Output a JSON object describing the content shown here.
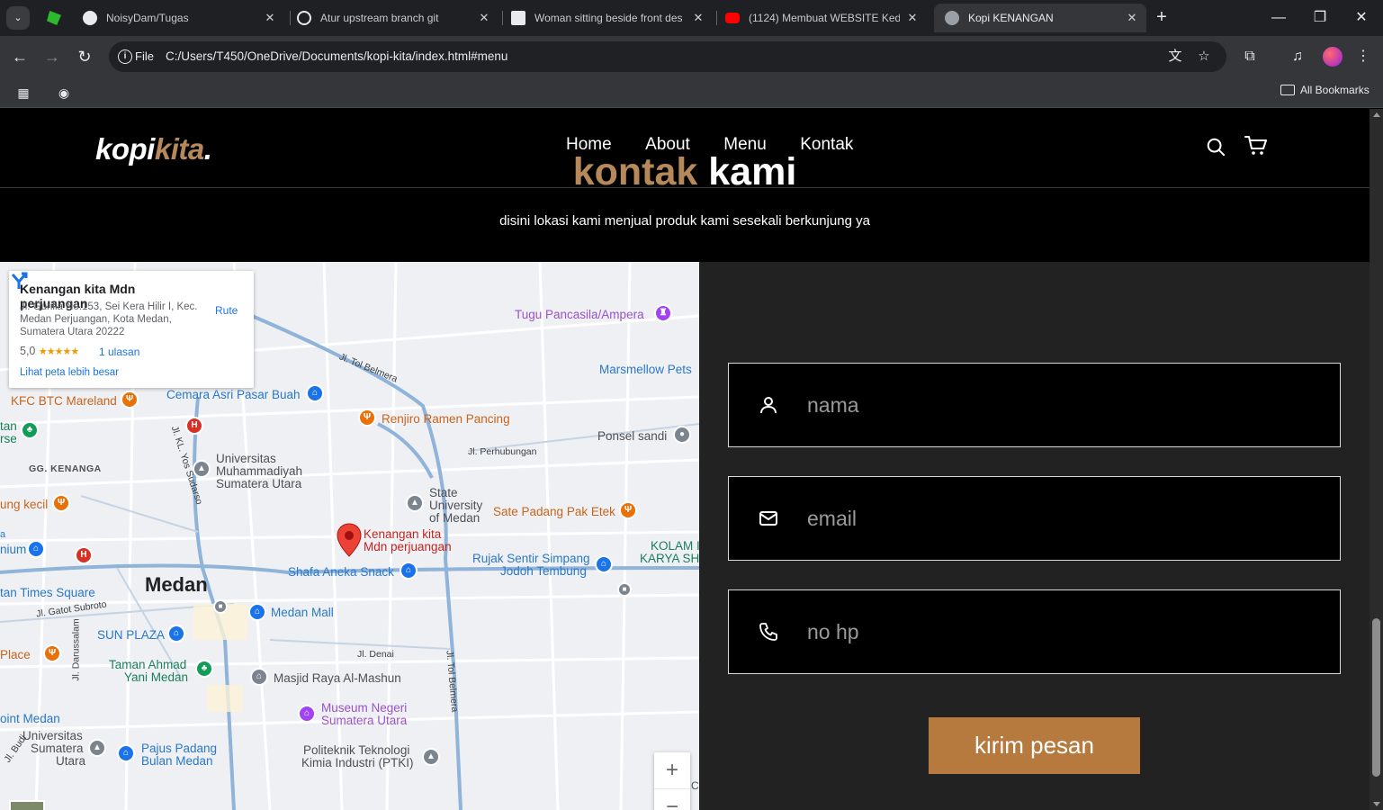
{
  "browser": {
    "tabs": [
      {
        "title": "NoisyDam/Tugas",
        "favicon": "github-icon"
      },
      {
        "title": "Atur upstream branch git",
        "favicon": "openai-icon"
      },
      {
        "title": "Woman sitting beside front des",
        "favicon": "unsplash-icon"
      },
      {
        "title": "(1124) Membuat WEBSITE Keda",
        "favicon": "youtube-icon"
      },
      {
        "title": "Kopi KENANGAN",
        "favicon": "globe-icon",
        "active": true
      }
    ],
    "omnibox": {
      "scheme_label": "File",
      "url": "C:/Users/T450/OneDrive/Documents/kopi-kita/index.html#menu"
    },
    "bookmarks": {
      "all_label": "All Bookmarks"
    }
  },
  "site": {
    "logo": {
      "main": "kopi",
      "accent": "kita",
      "dot": "."
    },
    "nav": [
      "Home",
      "About",
      "Menu",
      "Kontak"
    ],
    "section": {
      "title_accent": "kontak",
      "title_main": "kami",
      "subtitle": "disini lokasi kami menjual produk kami sesekali berkunjung ya"
    },
    "map": {
      "card": {
        "name": "Kenangan kita Mdn perjuangan",
        "address": "Jl. Gurilla No.153, Sei Kera Hilir I, Kec. Medan Perjuangan, Kota Medan, Sumatera Utara 20222",
        "rating": "5,0",
        "stars": "★★★★★",
        "reviews": "1 ulasan",
        "larger_map": "Lihat peta lebih besar",
        "route": "Rute"
      },
      "city": "Medan",
      "places": {
        "tugu": "Tugu Pancasila/Ampera",
        "marsmellow": "Marsmellow Pets",
        "cemara": "Cemara Asri Pasar Buah",
        "kfc": "KFC BTC Mareland",
        "renjiro": "Renjiro Ramen Pancing",
        "ponsel": "Ponsel sandi",
        "tan": "tan",
        "rse": "rse",
        "gg": "GG. KENANGA",
        "umsu": "Universitas Muhammadiyah Sumatera Utara",
        "state": "State University of Medan",
        "sate": "Sate Padang Pak Etek",
        "kecil": "ung kecil",
        "kenangan1": "Kenangan kita",
        "kenangan2": "Mdn perjuangan",
        "kolam1": "KOLAM I",
        "kolam2": "KARYA SH",
        "nium": "nium",
        "a": "a",
        "shafa": "Shafa Aneka Snack",
        "rujak1": "Rujak Sentir Simpang",
        "rujak2": "Jodoh Tembung",
        "times": "tan Times Square",
        "medanmall": "Medan Mall",
        "sunplaza": "SUN PLAZA",
        "place": "Place",
        "taman1": "Taman Ahmad",
        "taman2": "Yani Medan",
        "masjid": "Masjid Raya Al-Mashun",
        "museum1": "Museum Negeri",
        "museum2": "Sumatera Utara",
        "pointmedan": "oint Medan",
        "usu1": "Universitas",
        "usu2": "Sumatera",
        "usu3": "Utara",
        "pajus1": "Pajus Padang",
        "pajus2": "Bulan Medan",
        "poltek1": "Politeknik Teknologi",
        "poltek2": "Kimia Industri (PTKI)",
        "cin": "Cin"
      },
      "streets": {
        "tolbelmera": "Jl. Tol Belmera",
        "perhubungan": "Jl. Perhubungan",
        "yossudarso": "Jl. KL. Yos Sudarso",
        "gatot": "Jl. Gatot Subroto",
        "denai": "Jl. Denai",
        "darussalam": "Jl. Darussalam",
        "tolbelmera2": "Jl. Tol Belmera",
        "budi": "Jl. Budi"
      },
      "zoom_in": "+",
      "zoom_out": "−"
    },
    "form": {
      "name_placeholder": "nama",
      "email_placeholder": "email",
      "phone_placeholder": "no hp",
      "submit": "kirim pesan"
    },
    "colors": {
      "accent": "#b6895b",
      "button": "#b6793e",
      "form_bg": "#222222"
    }
  }
}
